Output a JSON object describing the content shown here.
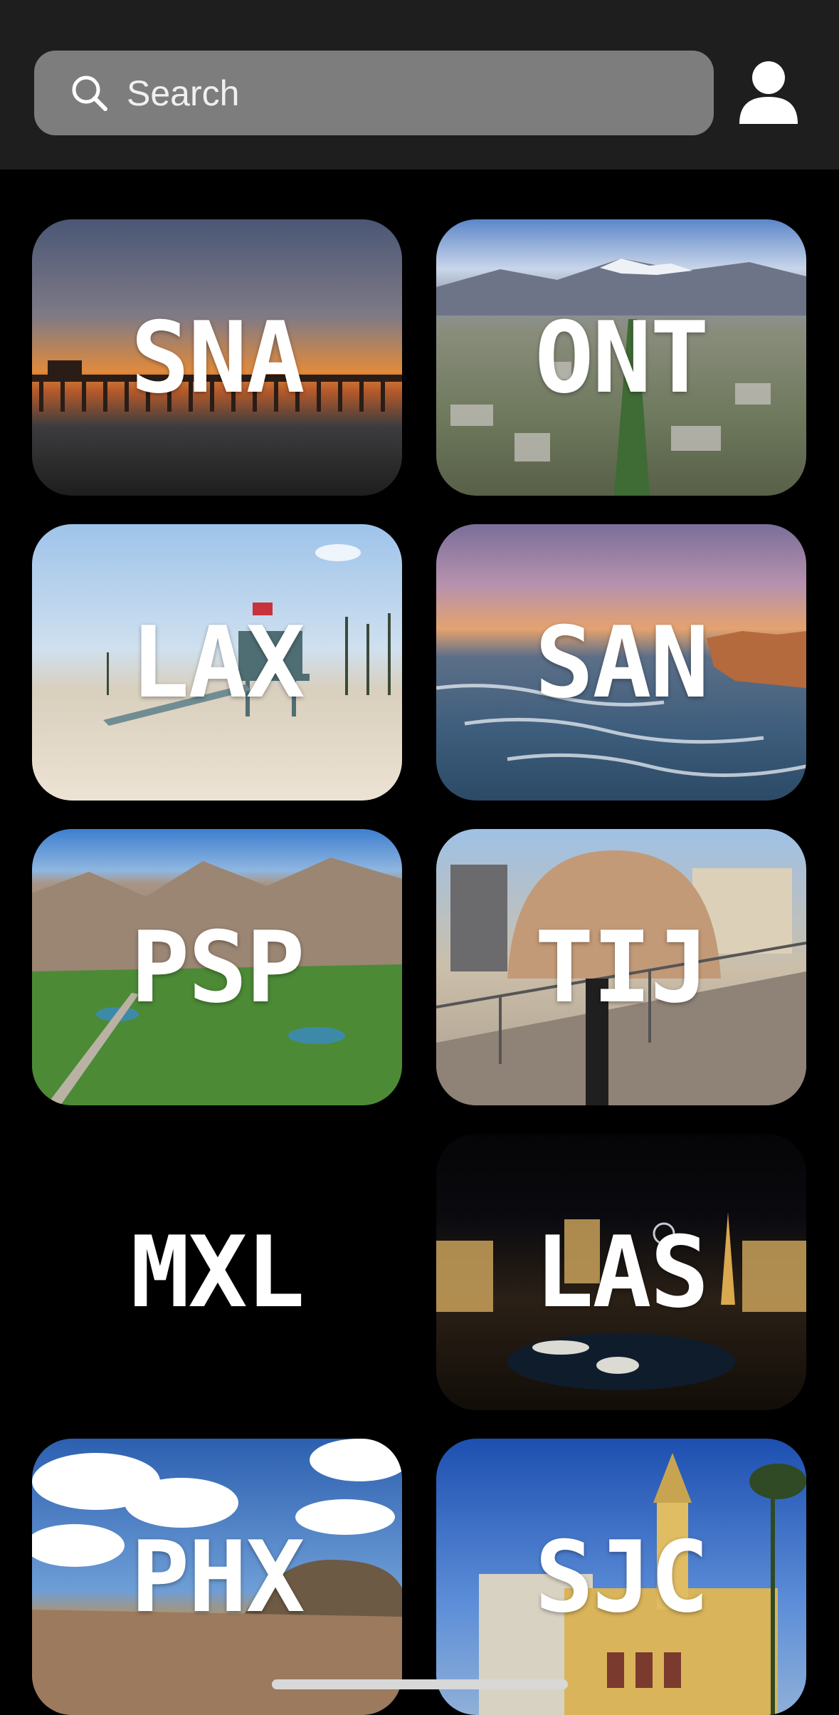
{
  "search": {
    "placeholder": "Search"
  },
  "airports": [
    {
      "code": "SNA",
      "scene": "pier-sunset"
    },
    {
      "code": "ONT",
      "scene": "city-mountains"
    },
    {
      "code": "LAX",
      "scene": "beach-lifeguard"
    },
    {
      "code": "SAN",
      "scene": "ocean-waves"
    },
    {
      "code": "PSP",
      "scene": "desert-golf"
    },
    {
      "code": "TIJ",
      "scene": "cultural-center"
    },
    {
      "code": "MXL",
      "scene": "none"
    },
    {
      "code": "LAS",
      "scene": "las-vegas-night"
    },
    {
      "code": "PHX",
      "scene": "desert-sky"
    },
    {
      "code": "SJC",
      "scene": "mission-church"
    }
  ],
  "colors": {
    "topbar": "#1e1e1e",
    "search_field": "#7d7d7d",
    "background": "#000000"
  }
}
